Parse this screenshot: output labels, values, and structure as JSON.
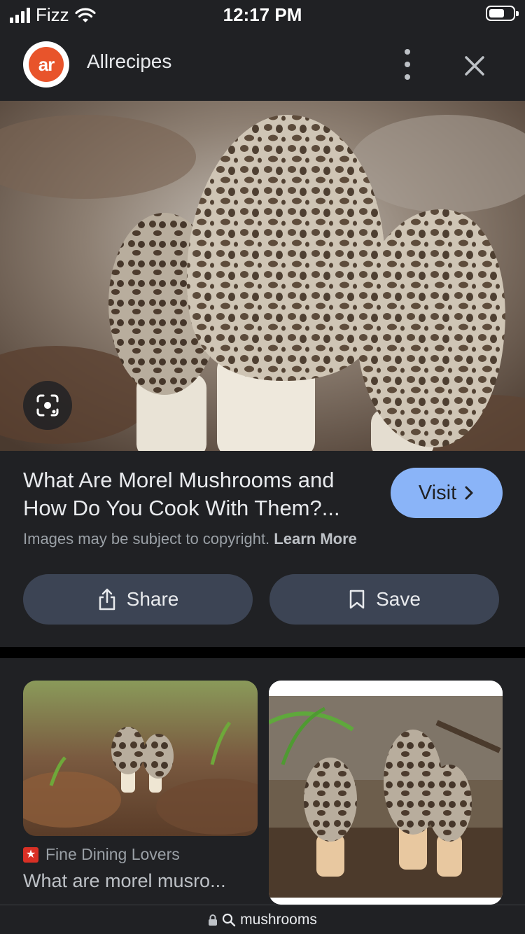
{
  "status_bar": {
    "carrier": "Fizz",
    "time": "12:17 PM",
    "battery_level": 0.65
  },
  "header": {
    "logo_text": "ar",
    "site_name": "Allrecipes",
    "menu_icon": "more-vert-icon",
    "close_icon": "close-icon"
  },
  "hero": {
    "lens_icon": "google-lens-icon"
  },
  "result": {
    "title": "What Are Morel Mushrooms and How Do You Cook With Them?...",
    "visit_label": "Visit",
    "copyright_text": "Images may be subject to copyright.",
    "learn_more": "Learn More",
    "share_label": "Share",
    "save_label": "Save"
  },
  "related": [
    {
      "source": "Fine Dining Lovers",
      "title": "What are morel musro..."
    },
    {
      "source": "",
      "title": ""
    }
  ],
  "url_bar": {
    "query": "mushrooms"
  },
  "colors": {
    "background": "#202124",
    "visit_button": "#8ab4f8",
    "pill_button": "#3c4454",
    "brand_orange": "#e8542b"
  }
}
